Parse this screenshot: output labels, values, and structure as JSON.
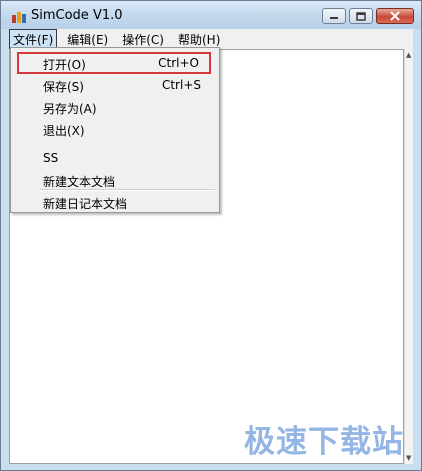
{
  "window": {
    "title": "SimCode V1.0",
    "controls": {
      "minimize": "minimize",
      "maximize": "maximize",
      "close": "close"
    }
  },
  "menubar": {
    "items": [
      {
        "label": "文件(F)",
        "active": true
      },
      {
        "label": "编辑(E)"
      },
      {
        "label": "操作(C)"
      },
      {
        "label": "帮助(H)"
      }
    ]
  },
  "file_menu": {
    "items": [
      {
        "label": "打开(O)",
        "shortcut": "Ctrl+O",
        "highlighted": true
      },
      {
        "label": "保存(S)",
        "shortcut": "Ctrl+S"
      },
      {
        "label": "另存为(A)"
      },
      {
        "label": "退出(X)"
      },
      {
        "label": "SS"
      },
      {
        "label": "新建文本文档"
      },
      {
        "label": "新建日记本文档"
      }
    ]
  },
  "watermark": {
    "text": "极速下载站"
  },
  "colors": {
    "highlight_border": "#d6373a",
    "watermark": "#3d7ccf"
  }
}
